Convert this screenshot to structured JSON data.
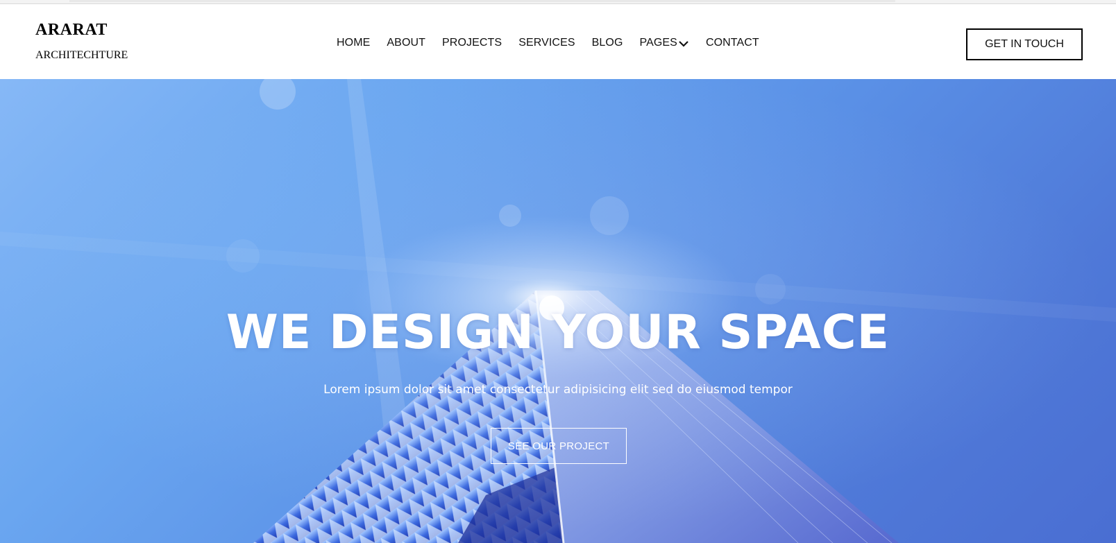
{
  "brand": {
    "name": "ARARAT",
    "tagline": "ARCHITECHTURE"
  },
  "nav": {
    "items": [
      {
        "label": "HOME"
      },
      {
        "label": "ABOUT"
      },
      {
        "label": "PROJECTS"
      },
      {
        "label": "SERVICES"
      },
      {
        "label": "BLOG"
      },
      {
        "label": "PAGES",
        "icon": "chevron-down-icon"
      },
      {
        "label": "CONTACT"
      }
    ]
  },
  "header": {
    "cta_label": "GET IN TOUCH"
  },
  "hero": {
    "title": "WE DESIGN YOUR SPACE",
    "subtitle": "Lorem ipsum dolor sit amet consectetur adipisicing elit sed do eiusmod tempor",
    "button_label": "SEE OUR PROJECT",
    "sky_color": "#6aa6f0",
    "building_color": "#2f4fc8"
  },
  "colors": {
    "nav_text": "#111111",
    "button_border": "#000000",
    "hero_text": "#ffffff"
  }
}
